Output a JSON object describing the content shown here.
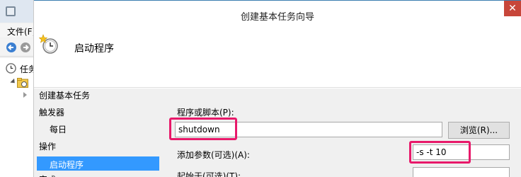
{
  "background_window": {
    "menu": {
      "file": "文件(F)"
    },
    "tree": {
      "root_label": "任务"
    }
  },
  "dialog": {
    "title": "创建基本任务向导",
    "close_glyph": "✕",
    "header_title": "启动程序",
    "nav": {
      "items": [
        {
          "label": "创建基本任务"
        },
        {
          "label": "触发器"
        },
        {
          "label": "每日"
        },
        {
          "label": "操作"
        },
        {
          "label": "启动程序",
          "selected": true
        },
        {
          "label": "完成"
        }
      ]
    },
    "form": {
      "program_label": "程序或脚本(P):",
      "program_value": "shutdown",
      "browse_label": "浏览(R)...",
      "args_label": "添加参数(可选)(A):",
      "args_value": "-s -t 10",
      "start_in_label": "起始于(可选)(T):",
      "start_in_value": ""
    }
  },
  "colors": {
    "highlight": "#e8196a",
    "selection": "#3399ff",
    "close": "#c7463a"
  }
}
